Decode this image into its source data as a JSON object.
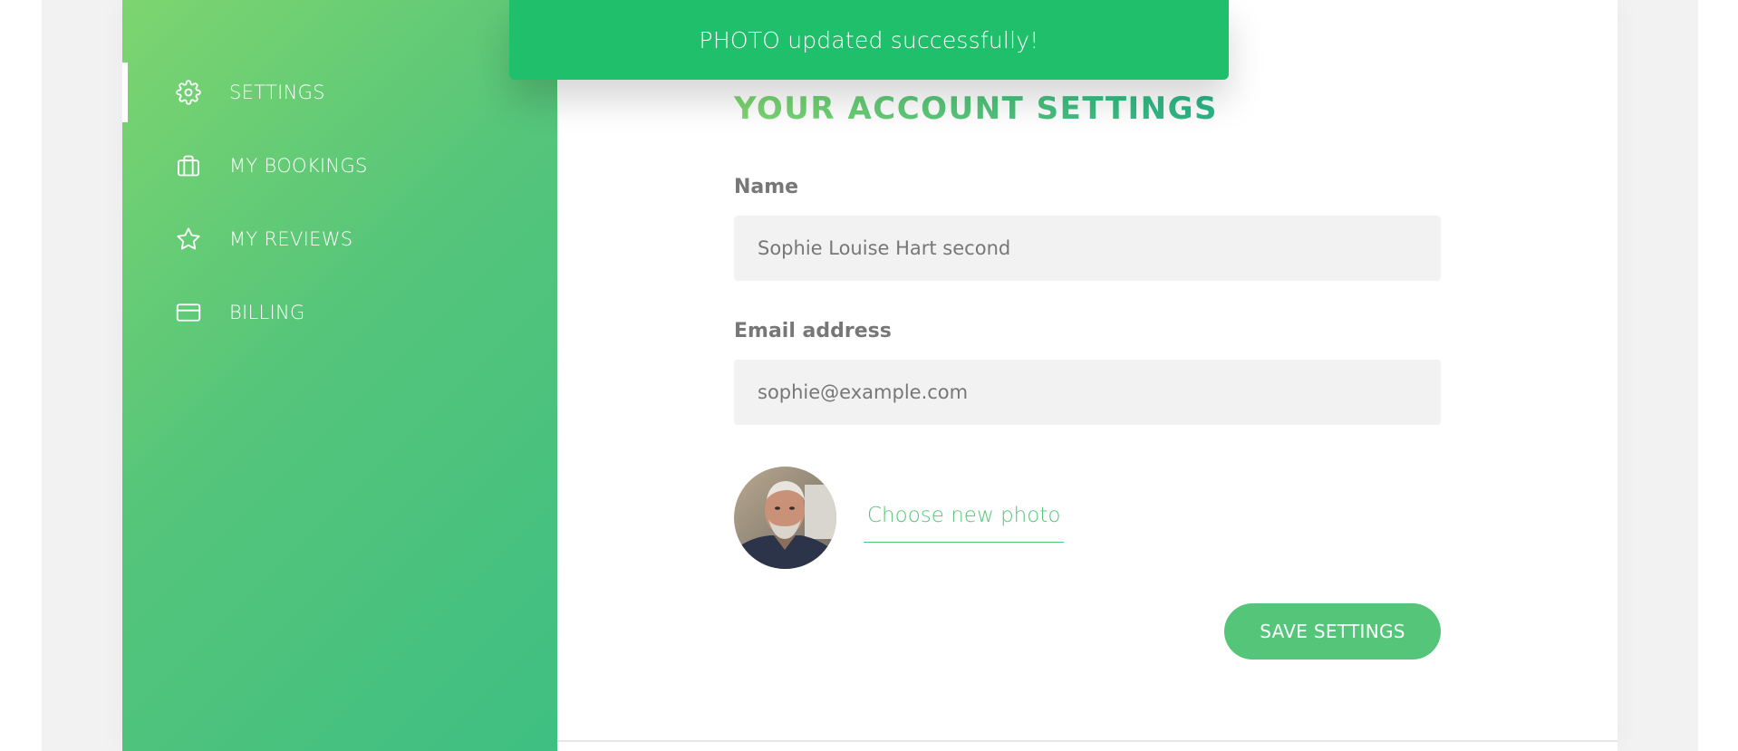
{
  "toast": {
    "message": "PHOTO updated successfully!"
  },
  "sidebar": {
    "items": [
      {
        "label": "SETTINGS",
        "icon": "settings-icon",
        "active": true
      },
      {
        "label": "MY BOOKINGS",
        "icon": "briefcase-icon",
        "active": false
      },
      {
        "label": "MY REVIEWS",
        "icon": "star-icon",
        "active": false
      },
      {
        "label": "BILLING",
        "icon": "credit-card-icon",
        "active": false
      }
    ]
  },
  "main": {
    "heading": "YOUR ACCOUNT SETTINGS",
    "name_field": {
      "label": "Name",
      "value": "Sophie Louise Hart second"
    },
    "email_field": {
      "label": "Email address",
      "value": "sophie@example.com"
    },
    "photo": {
      "choose_label": "Choose new photo"
    },
    "save_label": "SAVE SETTINGS"
  },
  "colors": {
    "toast": "#20bf6b",
    "brand_green": "#55c57a",
    "gradient_start": "#7dd56f",
    "gradient_end": "#28b487",
    "input_bg": "#f2f2f2",
    "label_text": "#777777"
  }
}
